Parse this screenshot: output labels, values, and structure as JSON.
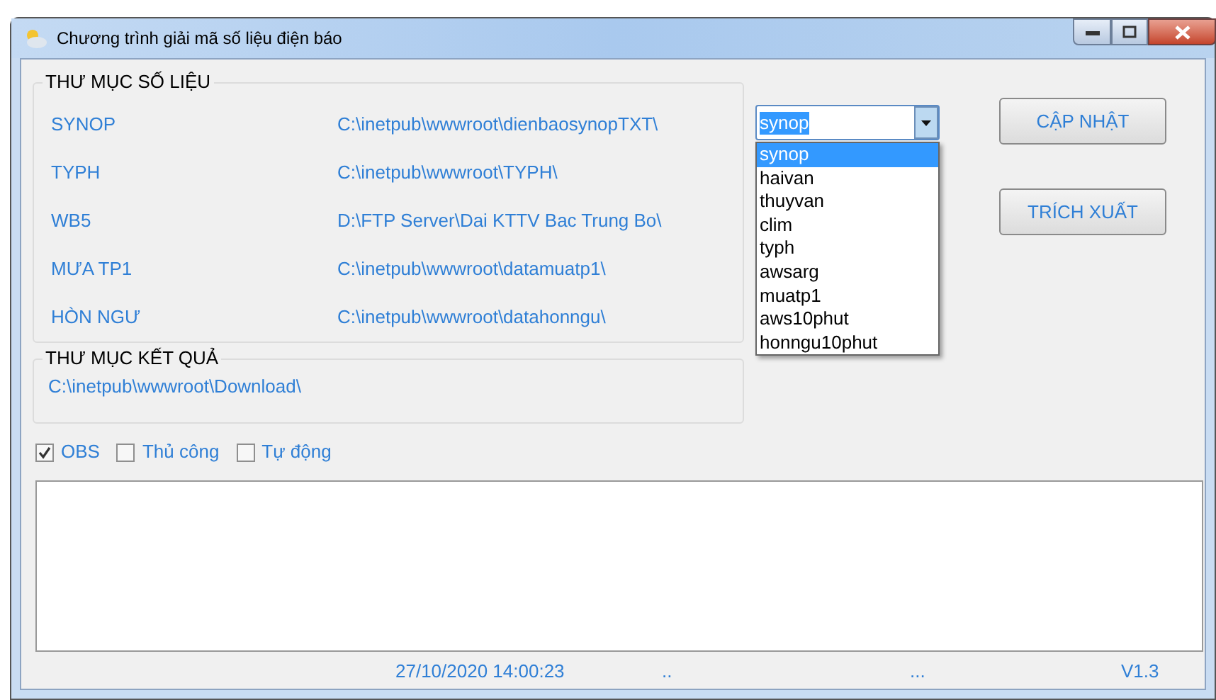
{
  "window": {
    "title": "Chương trình giải mã số liệu điện báo"
  },
  "data_folders": {
    "title": "THƯ MỤC SỐ LIỆU",
    "rows": [
      {
        "label": "SYNOP",
        "path": "C:\\inetpub\\wwwroot\\dienbaosynopTXT\\"
      },
      {
        "label": "TYPH",
        "path": "C:\\inetpub\\wwwroot\\TYPH\\"
      },
      {
        "label": "WB5",
        "path": "D:\\FTP Server\\Dai KTTV Bac Trung Bo\\"
      },
      {
        "label": "MƯA TP1",
        "path": "C:\\inetpub\\wwwroot\\datamuatp1\\"
      },
      {
        "label": "HÒN NGƯ",
        "path": "C:\\inetpub\\wwwroot\\datahonngu\\"
      }
    ]
  },
  "result_folder": {
    "title": "THƯ MỤC KẾT QUẢ",
    "path": "C:\\inetpub\\wwwroot\\Download\\"
  },
  "combo": {
    "value": "synop",
    "expanded": true,
    "options": [
      {
        "label": "synop",
        "selected": true
      },
      {
        "label": "haivan",
        "selected": false
      },
      {
        "label": "thuyvan",
        "selected": false
      },
      {
        "label": "clim",
        "selected": false
      },
      {
        "label": "typh",
        "selected": false
      },
      {
        "label": "awsarg",
        "selected": false
      },
      {
        "label": "muatp1",
        "selected": false
      },
      {
        "label": "aws10phut",
        "selected": false
      },
      {
        "label": "honngu10phut",
        "selected": false
      }
    ]
  },
  "buttons": [
    "CẬP NHẬT",
    "TRÍCH XUẤT"
  ],
  "checkboxes": [
    {
      "label": "OBS",
      "checked": true
    },
    {
      "label": "Thủ công",
      "checked": false
    },
    {
      "label": "Tự động",
      "checked": false
    }
  ],
  "status_bar": [
    "27/10/2020 14:00:23",
    "..",
    "...",
    "V1.3"
  ]
}
